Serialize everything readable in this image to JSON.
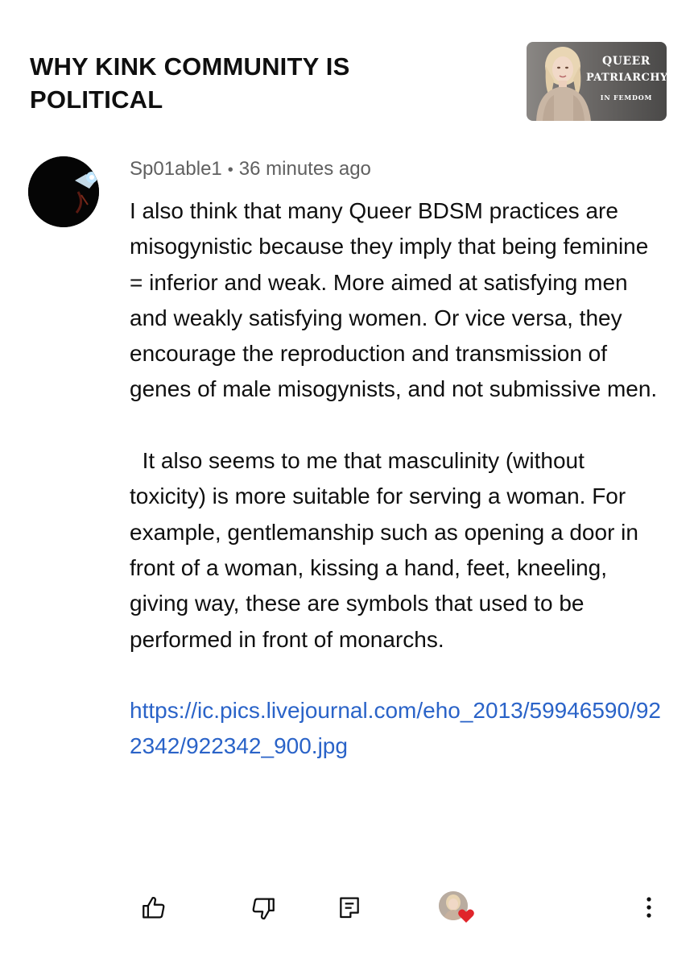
{
  "video": {
    "title": "WHY KINK COMMUNITY IS POLITICAL",
    "thumbnail": {
      "line1": "QUEER",
      "line2": "PATRIARCHY",
      "line3": "IN FEMDOM"
    }
  },
  "comment": {
    "author": "Sp01able1",
    "separator": "•",
    "timestamp": "36 minutes ago",
    "paragraph1": "I also think that many Queer BDSM practices are misogynistic because they imply that being feminine = inferior and weak. More aimed at satisfying men and weakly satisfying women. Or vice versa, they encourage the reproduction and transmission of genes of male misogynists, and not submissive men.",
    "paragraph2": "  It also seems to me that masculinity (without toxicity) is more suitable for serving a woman. For example, gentlemanship such as opening a door in front of a woman, kissing a hand, feet, kneeling, giving way, these are symbols that used to be performed in front of monarchs.",
    "link": "https://ic.pics.livejournal.com/eho_2013/59946590/922342/922342_900.jpg"
  },
  "actions": {
    "icons": [
      "thumbs-up-icon",
      "thumbs-down-icon",
      "reply-icon",
      "creator-heart-icon",
      "more-vert-icon"
    ]
  },
  "colors": {
    "text": "#0f0f0f",
    "meta": "#606060",
    "link": "#2a63c8",
    "heart": "#e0242a"
  }
}
